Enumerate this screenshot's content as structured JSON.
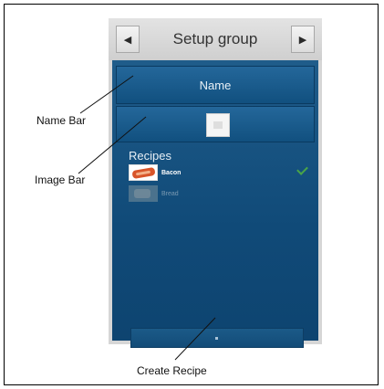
{
  "header": {
    "title": "Setup group",
    "prev_icon": "triangle-left-icon",
    "next_icon": "triangle-right-icon"
  },
  "name_bar": {
    "label": "Name"
  },
  "image_bar": {
    "thumbnail_icon": "image-placeholder-icon"
  },
  "recipes": {
    "heading": "Recipes",
    "items": [
      {
        "name": "Bacon",
        "selected": true,
        "icon": "bacon-thumbnail"
      },
      {
        "name": "Bread",
        "selected": false,
        "icon": "bread-thumbnail"
      }
    ]
  },
  "annotations": {
    "name_bar": "Name Bar",
    "image_bar": "Image Bar",
    "create_recipe": "Create Recipe"
  },
  "colors": {
    "panel": "#104a78",
    "bar": "#1a5a8c",
    "check": "#4aa548"
  }
}
